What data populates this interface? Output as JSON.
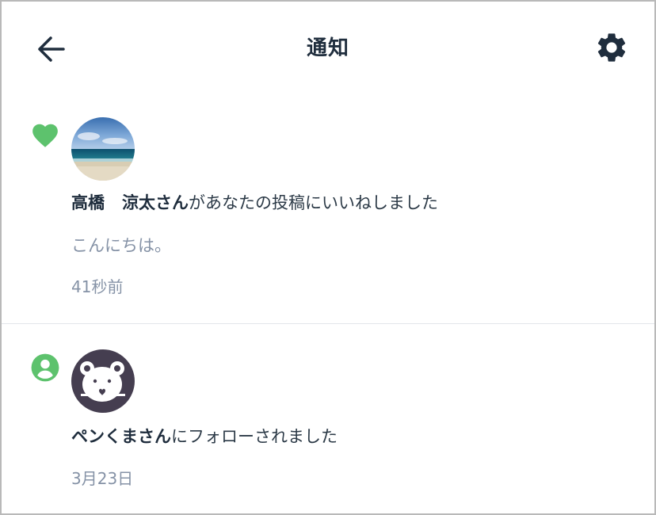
{
  "header": {
    "title": "通知",
    "back_icon": "arrow-left-icon",
    "settings_icon": "gear-icon"
  },
  "notifications": [
    {
      "type_icon": "heart-icon",
      "avatar": "beach-photo",
      "user_last": "高橋",
      "user_first": "涼太",
      "honorific": "さん",
      "action": "があなたの投稿にいいねしました",
      "post_preview": "こんにちは。",
      "time": "41秒前"
    },
    {
      "type_icon": "user-icon",
      "avatar": "bear-avatar",
      "user_name": "ペンくまさん",
      "action": "にフォローされました",
      "time": "3月23日"
    }
  ],
  "colors": {
    "accent_green": "#5dc26d",
    "text_dark": "#1f2d3d",
    "text_muted": "#8592a6",
    "bear_bg": "#453e50"
  }
}
